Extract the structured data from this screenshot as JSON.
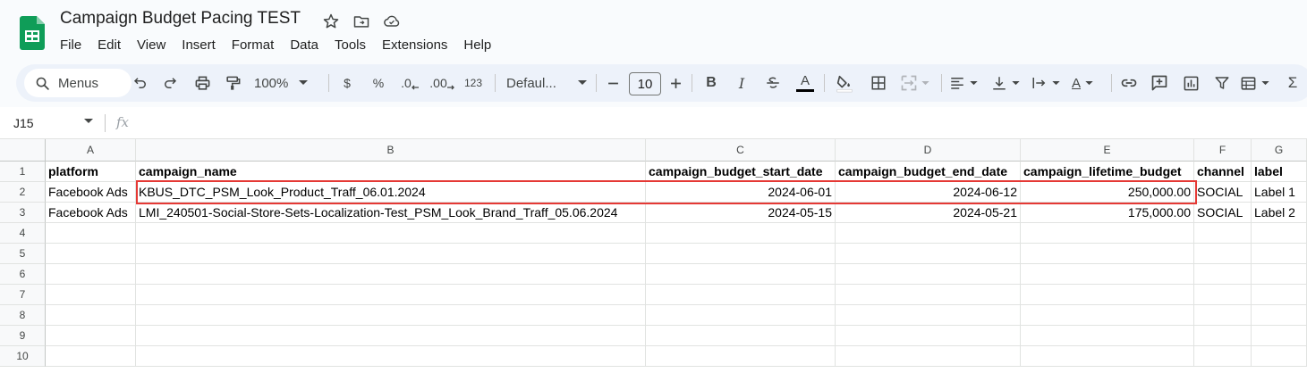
{
  "doc": {
    "title": "Campaign Budget Pacing TEST"
  },
  "menu": [
    "File",
    "Edit",
    "View",
    "Insert",
    "Format",
    "Data",
    "Tools",
    "Extensions",
    "Help"
  ],
  "toolbar": {
    "search_label": "Menus",
    "zoom": "100%",
    "currency": "$",
    "percent": "%",
    "dec_decrease": ".0",
    "dec_increase": ".00",
    "number_format": "123",
    "font": "Defaul...",
    "font_size": "10",
    "bold": "B",
    "italic": "I",
    "text_color": "A",
    "text_rotation": "A",
    "sum": "Σ"
  },
  "formula_bar": {
    "cell_ref": "J15",
    "fx": "fx"
  },
  "columns": [
    "A",
    "B",
    "C",
    "D",
    "E",
    "F",
    "G"
  ],
  "row_numbers": [
    "1",
    "2",
    "3",
    "4",
    "5",
    "6",
    "7",
    "8",
    "9",
    "10"
  ],
  "rows": [
    [
      "platform",
      "campaign_name",
      "campaign_budget_start_date",
      "campaign_budget_end_date",
      "campaign_lifetime_budget",
      "channel",
      "label"
    ],
    [
      "Facebook Ads",
      "KBUS_DTC_PSM_Look_Product_Traff_06.01.2024",
      "2024-06-01",
      "2024-06-12",
      "250,000.00",
      "SOCIAL",
      "Label 1"
    ],
    [
      "Facebook Ads",
      "LMI_240501-Social-Store-Sets-Localization-Test_PSM_Look_Brand_Traff_05.06.2024",
      "2024-05-15",
      "2024-05-21",
      "175,000.00",
      "SOCIAL",
      "Label 2"
    ]
  ],
  "colors": {
    "highlight": "#e53935",
    "logo_green": "#0f9d58",
    "toolbar_bg": "#edf2fa"
  }
}
